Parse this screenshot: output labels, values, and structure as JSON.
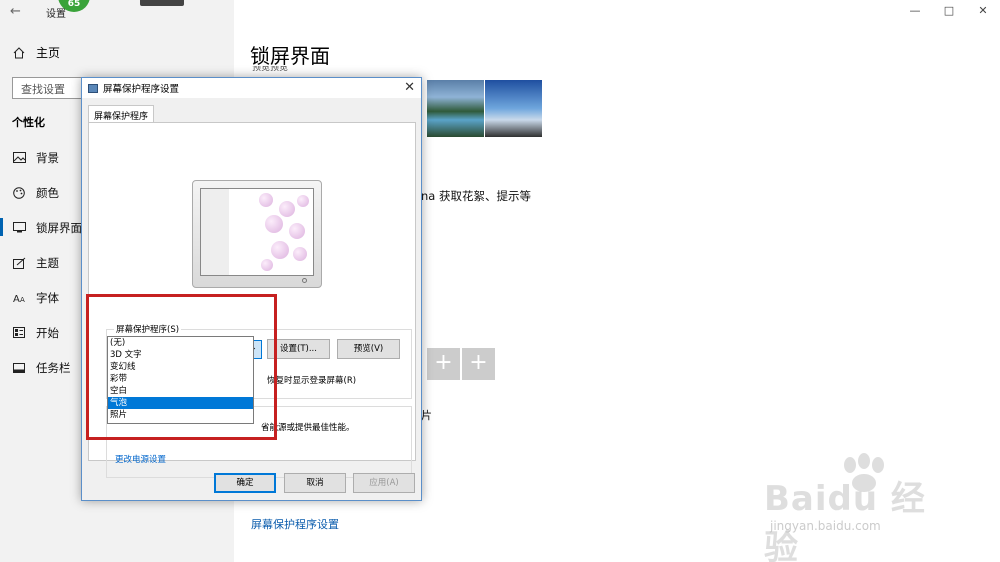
{
  "app": {
    "title": "设置",
    "badge": "65"
  },
  "sidebar": {
    "home_label": "主页",
    "search_placeholder": "查找设置",
    "section_title": "个性化",
    "items": [
      {
        "label": "背景",
        "icon": "image-icon"
      },
      {
        "label": "颜色",
        "icon": "palette-icon"
      },
      {
        "label": "锁屏界面",
        "icon": "lockscreen-icon",
        "active": true
      },
      {
        "label": "主题",
        "icon": "theme-icon"
      },
      {
        "label": "字体",
        "icon": "font-icon"
      },
      {
        "label": "开始",
        "icon": "start-icon"
      },
      {
        "label": "任务栏",
        "icon": "taskbar-icon"
      }
    ]
  },
  "main": {
    "title": "锁屏界面",
    "partial_text": "na 获取花絮、提示等",
    "char_partial": "片",
    "bottom_link": "屏幕保护程序设置",
    "plus_symbol": "+"
  },
  "window_controls": {
    "minimize": "—",
    "maximize": "□",
    "close": "✕"
  },
  "dialog": {
    "title": "屏幕保护程序设置",
    "tab": "屏幕保护程序",
    "group_label": "屏幕保护程序(S)",
    "selected_value": "气泡",
    "settings_button": "设置(T)...",
    "preview_button": "预览(V)",
    "resume_text": "恢复时显示登录屏幕(R)",
    "options": [
      "(无)",
      "3D 文字",
      "变幻线",
      "彩带",
      "空白",
      "气泡",
      "照片"
    ],
    "selected_index": 5,
    "power_text": "省能源或提供最佳性能。",
    "power_link": "更改电源设置",
    "ok": "确定",
    "cancel": "取消",
    "apply": "应用(A)"
  },
  "watermark": {
    "brand": "Baidu 经验",
    "url": "jingyan.baidu.com"
  },
  "colors": {
    "accent": "#0078d7",
    "highlight_box": "#c62020"
  }
}
